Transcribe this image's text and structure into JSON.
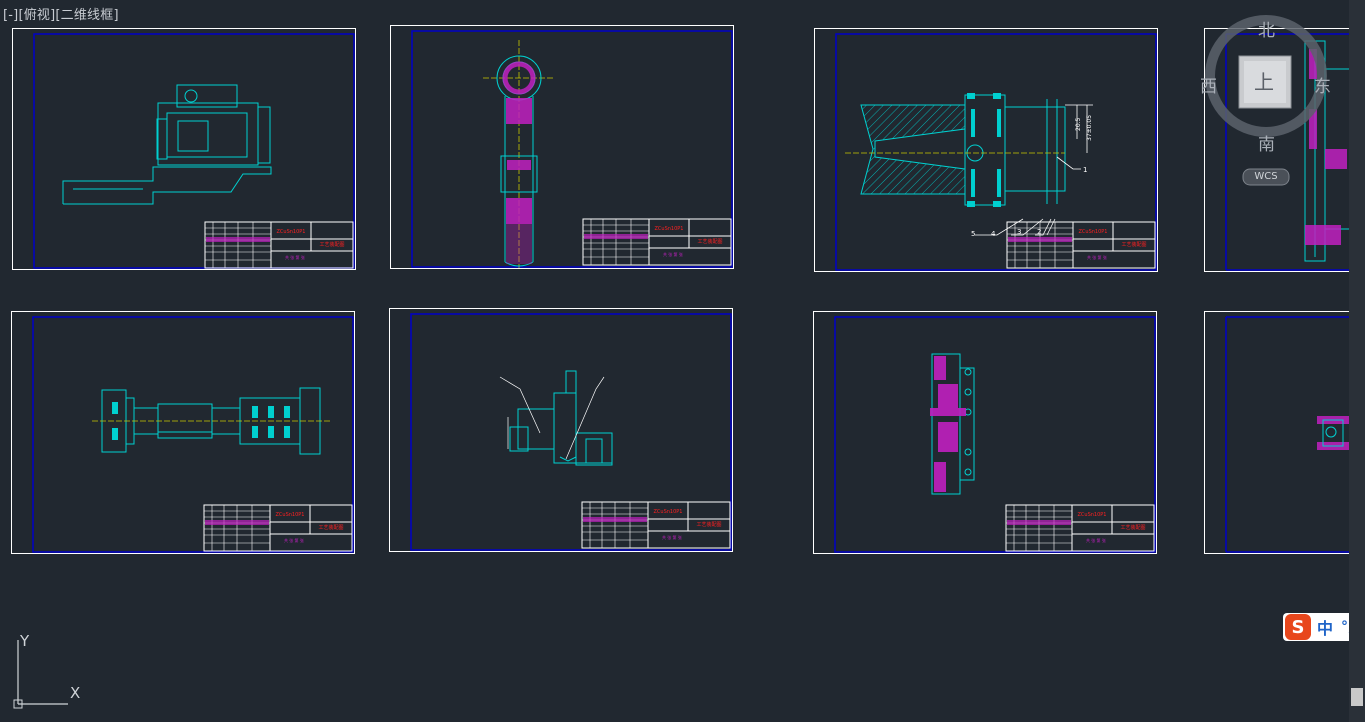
{
  "viewport": {
    "control": "[-]",
    "view": "[俯视]",
    "style": "[二维线框]"
  },
  "navcube": {
    "north": "北",
    "south": "南",
    "east": "东",
    "west": "西",
    "face": "上",
    "wcs": "WCS"
  },
  "ucs": {
    "x_label": "X",
    "y_label": "Y"
  },
  "ime": {
    "logo": "S",
    "mode": "中",
    "punct": "°,"
  },
  "title_block": {
    "material": "ZCuSn10P1",
    "name": "工艺装配图",
    "footer": "共 张 第 张"
  },
  "sheet_annotations": {
    "dim_a": "20.5",
    "dim_b": "37±0.05",
    "callout_1": "1",
    "callout_2": "2",
    "callout_3": "3",
    "callout_4": "4",
    "callout_5": "5"
  },
  "colors": {
    "background": "#212830",
    "geometry": "#00d0d0",
    "hatch": "#c020c0",
    "frame": "#0000c8",
    "title_text": "#ff2020",
    "center_line": "#c8c800"
  }
}
